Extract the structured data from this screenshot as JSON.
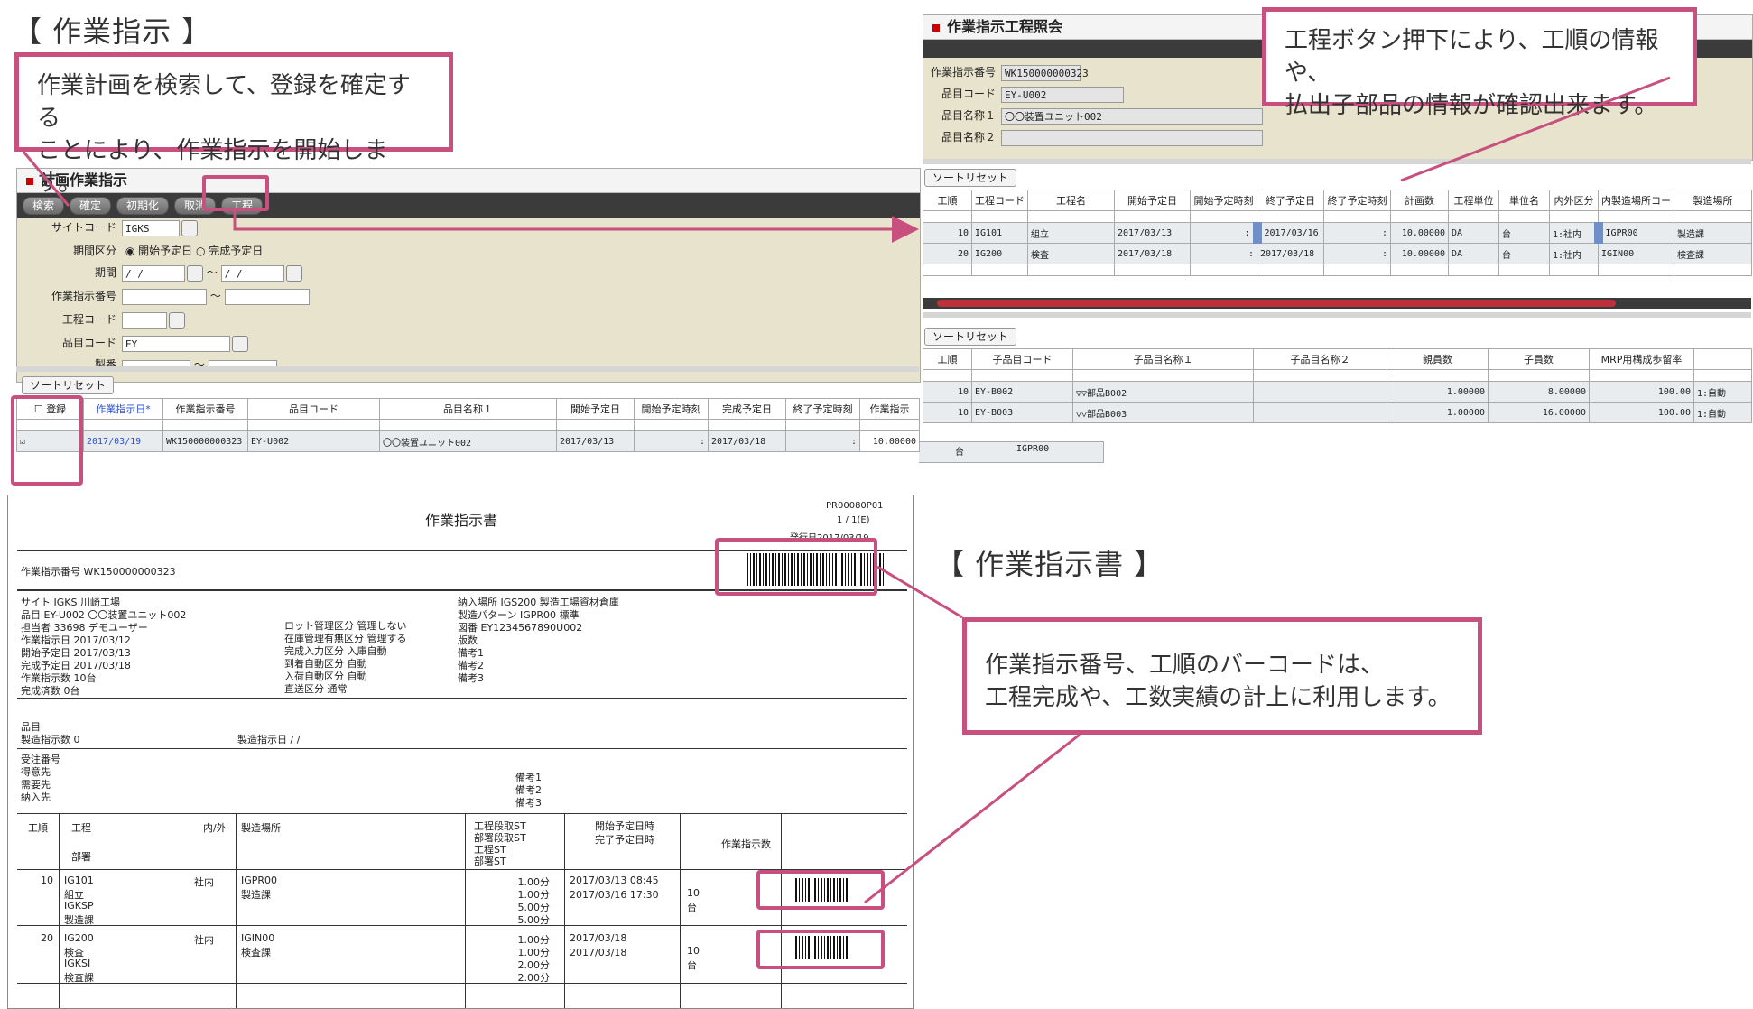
{
  "sections": {
    "work_instruction": "【 作業指示 】",
    "work_doc": "【 作業指示書 】"
  },
  "callouts": {
    "search": [
      "作業計画を検索して、登録を確定する",
      "ことにより、作業指示を開始します。"
    ],
    "process": [
      "工程ボタン押下により、工順の情報や、",
      "払出子部品の情報が確認出来ます。"
    ],
    "barcode": [
      "作業指示番号、工順のバーコードは、",
      "工程完成や、工数実績の計上に利用します。"
    ]
  },
  "plan_panel": {
    "title": "計画作業指示",
    "buttons": [
      "検索",
      "確定",
      "初期化",
      "取消",
      "工程"
    ],
    "fields": {
      "site_label": "サイトコード",
      "site_value": "IGKS",
      "period_type_label": "期間区分",
      "radio_start": "開始予定日",
      "radio_end": "完成予定日",
      "period_label": "期間",
      "date_ph": " /  /",
      "tilde": "～",
      "order_no_label": "作業指示番号",
      "process_code_label": "工程コード",
      "item_code_label": "品目コード",
      "item_code_value": "EY",
      "lot_label": "製番"
    },
    "sort_reset": "ソートリセット",
    "grid_headers": [
      "登録",
      "作業指示日*",
      "作業指示番号",
      "品目コード",
      "品目名称１",
      "開始予定日",
      "開始予定時刻",
      "完成予定日",
      "終了予定時刻",
      "作業指示"
    ],
    "row": {
      "date": "2017/03/19",
      "order_no": "WK150000000323",
      "item_code": "EY-U002",
      "item_name": "〇〇装置ユニット002",
      "start": "2017/03/13",
      "start_time": ":",
      "end": "2017/03/18",
      "end_time": ":",
      "qty": "10.00000",
      "unit": "台",
      "loc": "IGPR00"
    }
  },
  "process_panel": {
    "title": "作業指示工程照会",
    "fields": {
      "order_no_label": "作業指示番号",
      "order_no": "WK150000000323",
      "item_code_label": "品目コード",
      "item_code": "EY-U002",
      "item_name1_label": "品目名称１",
      "item_name1": "〇〇装置ユニット002",
      "item_name2_label": "品目名称２"
    },
    "sort_reset": "ソートリセット",
    "grid1_headers": [
      "工順",
      "工程コード",
      "工程名",
      "開始予定日",
      "開始予定時刻",
      "終了予定日",
      "終了予定時刻",
      "計画数",
      "工程単位",
      "単位名",
      "内外区分",
      "内製造場所コー",
      "製造場所"
    ],
    "grid1_rows": [
      [
        "10",
        "IG101",
        "組立",
        "2017/03/13",
        ":",
        "2017/03/16",
        ":",
        "10.00000",
        "DA",
        "台",
        "1:社内",
        "IGPR00",
        "製造課"
      ],
      [
        "20",
        "IG200",
        "検査",
        "2017/03/18",
        ":",
        "2017/03/18",
        ":",
        "10.00000",
        "DA",
        "台",
        "1:社内",
        "IGIN00",
        "検査課"
      ]
    ],
    "grid2_headers": [
      "工順",
      "子品目コード",
      "子品目名称１",
      "子品目名称２",
      "親員数",
      "子員数",
      "MRP用構成歩留率",
      ""
    ],
    "grid2_rows": [
      [
        "10",
        "EY-B002",
        "▽▽部品B002",
        "",
        "1.00000",
        "8.00000",
        "100.00",
        "1:自動"
      ],
      [
        "10",
        "EY-B003",
        "▽▽部品B003",
        "",
        "1.00000",
        "16.00000",
        "100.00",
        "1:自動"
      ]
    ]
  },
  "doc": {
    "title": "作業指示書",
    "form_id": "PR00080P01",
    "page": "1 /   1(E)",
    "issue": "発行日2017/03/19",
    "order_line": "作業指示番号 WK150000000323",
    "left_block": [
      "サイト  IGKS 川崎工場",
      "品目    EY-U002 〇〇装置ユニット002",
      "担当者  33698 デモユーザー",
      "作業指示日 2017/03/12",
      "開始予定日 2017/03/13",
      "完成予定日 2017/03/18",
      "作業指示数 10台",
      "完成済数   0台"
    ],
    "mid_block": [
      "ロット管理区分  管理しない",
      "在庫管理有無区分 管理する",
      "完成入力区分    入庫自動",
      "到着自動区分    自動",
      "入荷自動区分    自動",
      "直送区分        通常"
    ],
    "right_block": [
      "納入場所     IGS200 製造工場資材倉庫",
      "製造パターン IGPR00 標準",
      "図番  EY1234567890U002",
      "版数",
      "備考1",
      "備考2",
      "備考3"
    ],
    "item_label": "品目",
    "mfg_qty": "製造指示数    0",
    "mfg_date": "製造指示日     /  /",
    "order_block": [
      "受注番号",
      "得意先",
      "需要先",
      "納入先"
    ],
    "notes_block": [
      "備考1",
      "備考2",
      "備考3"
    ],
    "table_head": {
      "seq": "工順",
      "process": "工程",
      "inout": "内/外",
      "place": "製造場所",
      "sub": "部署",
      "st": [
        "工程段取ST",
        "部署段取ST",
        "工程ST",
        "部署ST"
      ],
      "dates": [
        "開始予定日時",
        "完了予定日時"
      ],
      "qty": "作業指示数"
    },
    "rows": [
      {
        "seq": "10",
        "lines": [
          "IG101",
          "組立",
          "IGKSP",
          "製造課"
        ],
        "inout": "社内",
        "place": [
          "IGPR00",
          "製造課"
        ],
        "st": [
          "1.00分",
          "1.00分",
          "5.00分",
          "5.00分"
        ],
        "dates": [
          "2017/03/13 08:45",
          "2017/03/16 17:30"
        ],
        "qty": [
          "10",
          "台"
        ]
      },
      {
        "seq": "20",
        "lines": [
          "IG200",
          "検査",
          "IGKSI",
          "検査課"
        ],
        "inout": "社内",
        "place": [
          "IGIN00",
          "検査課"
        ],
        "st": [
          "1.00分",
          "1.00分",
          "2.00分",
          "2.00分"
        ],
        "dates": [
          "2017/03/18",
          "2017/03/18"
        ],
        "qty": [
          "10",
          "台"
        ]
      }
    ]
  },
  "colors": {
    "accent": "#c8507e",
    "toolbar": "#3b3b3b",
    "panel_bg": "#e8e3cc",
    "row_blue": "#6f8fc8",
    "scroll_red": "#c0303a"
  }
}
